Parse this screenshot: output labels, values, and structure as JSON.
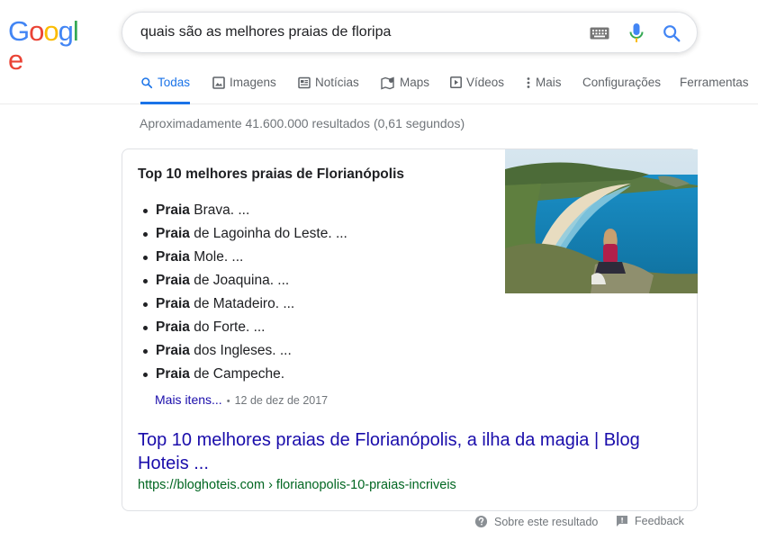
{
  "logo": {
    "text": "Google"
  },
  "search": {
    "query": "quais são as melhores praias de floripa"
  },
  "tabs": [
    {
      "label": "Todas",
      "icon": "search-icon",
      "active": true
    },
    {
      "label": "Imagens",
      "icon": "image-icon"
    },
    {
      "label": "Notícias",
      "icon": "news-icon"
    },
    {
      "label": "Maps",
      "icon": "map-icon"
    },
    {
      "label": "Vídeos",
      "icon": "video-icon"
    },
    {
      "label": "Mais",
      "icon": "more-vert-icon"
    },
    {
      "label": "Configurações"
    },
    {
      "label": "Ferramentas"
    }
  ],
  "stats": "Aproximadamente 41.600.000 resultados (0,61 segundos)",
  "snippet": {
    "title": "Top 10 melhores praias de Florianópolis",
    "items": [
      {
        "bold": "Praia",
        "rest": " Brava. ..."
      },
      {
        "bold": "Praia",
        "rest": " de Lagoinha do Leste. ..."
      },
      {
        "bold": "Praia",
        "rest": " Mole. ..."
      },
      {
        "bold": "Praia",
        "rest": " de Joaquina. ..."
      },
      {
        "bold": "Praia",
        "rest": " de Matadeiro. ..."
      },
      {
        "bold": "Praia",
        "rest": " do Forte. ..."
      },
      {
        "bold": "Praia",
        "rest": " dos Ingleses. ..."
      },
      {
        "bold": "Praia",
        "rest": " de Campeche."
      }
    ],
    "more_link": "Mais itens...",
    "separator": "•",
    "date": "12 de dez de 2017",
    "result_title": "Top 10 melhores praias de Florianópolis, a ilha da magia | Blog Hoteis ...",
    "result_url": "https://bloghoteis.com › florianopolis-10-praias-incriveis"
  },
  "footer": {
    "about": "Sobre este resultado",
    "feedback": "Feedback"
  },
  "colors": {
    "accent": "#1a73e8",
    "link": "#1a0dab",
    "url_green": "#006621",
    "muted": "#70757a"
  }
}
